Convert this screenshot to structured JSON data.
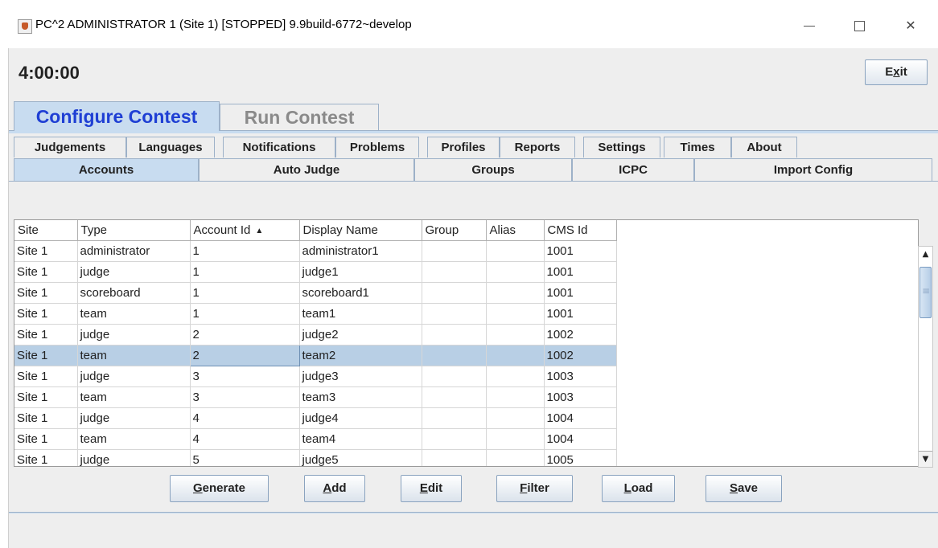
{
  "window": {
    "title": "PC^2 ADMINISTRATOR 1 (Site 1) [STOPPED] 9.9build-6772~develop",
    "minimize": "—",
    "close": "✕"
  },
  "header": {
    "clock": "4:00:00",
    "exit_pre": "E",
    "exit_mn": "x",
    "exit_post": "it"
  },
  "top_tabs": [
    "Configure Contest",
    "Run Contest"
  ],
  "sub_tabs_row1": [
    "Judgements",
    "Languages",
    "Notifications",
    "Problems",
    "Profiles",
    "Reports",
    "Settings",
    "Times",
    "About"
  ],
  "sub_tabs_row2": [
    "Accounts",
    "Auto Judge",
    "Groups",
    "ICPC",
    "Import Config"
  ],
  "table": {
    "columns": [
      "Site",
      "Type",
      "Account Id",
      "Display Name",
      "Group",
      "Alias",
      "CMS Id"
    ],
    "sort_indicator": "▲",
    "rows": [
      [
        "Site 1",
        "administrator",
        "1",
        "administrator1",
        "",
        "",
        "1001"
      ],
      [
        "Site 1",
        "judge",
        "1",
        "judge1",
        "",
        "",
        "1001"
      ],
      [
        "Site 1",
        "scoreboard",
        "1",
        "scoreboard1",
        "",
        "",
        "1001"
      ],
      [
        "Site 1",
        "team",
        "1",
        "team1",
        "",
        "",
        "1001"
      ],
      [
        "Site 1",
        "judge",
        "2",
        "judge2",
        "",
        "",
        "1002"
      ],
      [
        "Site 1",
        "team",
        "2",
        "team2",
        "",
        "",
        "1002"
      ],
      [
        "Site 1",
        "judge",
        "3",
        "judge3",
        "",
        "",
        "1003"
      ],
      [
        "Site 1",
        "team",
        "3",
        "team3",
        "",
        "",
        "1003"
      ],
      [
        "Site 1",
        "judge",
        "4",
        "judge4",
        "",
        "",
        "1004"
      ],
      [
        "Site 1",
        "team",
        "4",
        "team4",
        "",
        "",
        "1004"
      ],
      [
        "Site 1",
        "judge",
        "5",
        "judge5",
        "",
        "",
        "1005"
      ]
    ]
  },
  "buttons": {
    "generate": {
      "mn": "G",
      "rest": "enerate"
    },
    "add": {
      "mn": "A",
      "rest": "dd"
    },
    "edit": {
      "mn": "E",
      "rest": "dit"
    },
    "filter": {
      "mn": "F",
      "rest": "ilter"
    },
    "load": {
      "mn": "L",
      "rest": "oad"
    },
    "save": {
      "mn": "S",
      "rest": "ave"
    }
  }
}
